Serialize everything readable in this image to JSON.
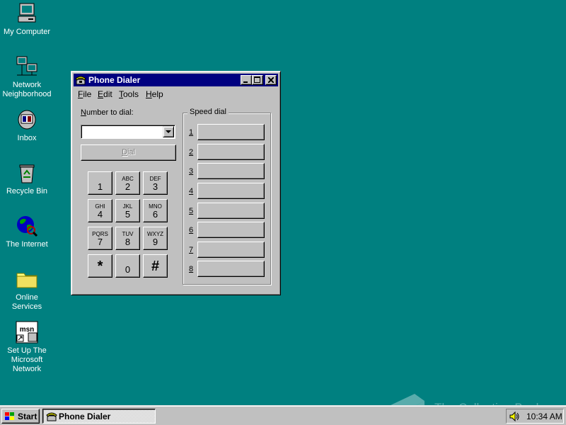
{
  "desktop": {
    "icons": [
      {
        "label_lines": [
          "My Computer"
        ],
        "icon": "my-computer-icon"
      },
      {
        "label_lines": [
          "Network",
          "Neighborhood"
        ],
        "icon": "network-neighborhood-icon"
      },
      {
        "label_lines": [
          "Inbox"
        ],
        "icon": "inbox-icon"
      },
      {
        "label_lines": [
          "Recycle Bin"
        ],
        "icon": "recycle-bin-icon"
      },
      {
        "label_lines": [
          "The Internet"
        ],
        "icon": "internet-icon"
      },
      {
        "label_lines": [
          "Online",
          "Services"
        ],
        "icon": "folder-icon"
      },
      {
        "label_lines": [
          "Set Up The",
          "Microsoft",
          "Network"
        ],
        "icon": "msn-icon"
      }
    ],
    "background_color": "#008080"
  },
  "window": {
    "title": "Phone Dialer",
    "menu": {
      "file": {
        "u": "F",
        "rest": "ile"
      },
      "edit": {
        "u": "E",
        "rest": "dit"
      },
      "tools": {
        "u": "T",
        "rest": "ools"
      },
      "help": {
        "u": "H",
        "rest": "elp"
      }
    },
    "number_label": {
      "u": "N",
      "rest": "umber to dial:"
    },
    "number_value": "",
    "dial_button": {
      "u": "D",
      "rest": "ial"
    },
    "keypad": [
      {
        "letters": "",
        "digit": "1"
      },
      {
        "letters": "ABC",
        "digit": "2"
      },
      {
        "letters": "DEF",
        "digit": "3"
      },
      {
        "letters": "GHI",
        "digit": "4"
      },
      {
        "letters": "JKL",
        "digit": "5"
      },
      {
        "letters": "MNO",
        "digit": "6"
      },
      {
        "letters": "PQRS",
        "digit": "7"
      },
      {
        "letters": "TUV",
        "digit": "8"
      },
      {
        "letters": "WXYZ",
        "digit": "9"
      },
      {
        "letters": "",
        "digit": "*"
      },
      {
        "letters": "",
        "digit": "0"
      },
      {
        "letters": "",
        "digit": "#"
      }
    ],
    "speed_dial": {
      "title": "Speed dial",
      "entries": [
        "1",
        "2",
        "3",
        "4",
        "5",
        "6",
        "7",
        "8"
      ]
    },
    "title_bar_color": "#000080"
  },
  "taskbar": {
    "start_label": "Start",
    "task_label": "Phone Dialer",
    "clock": "10:34 AM"
  },
  "watermark": {
    "text": "The Collection Book"
  }
}
